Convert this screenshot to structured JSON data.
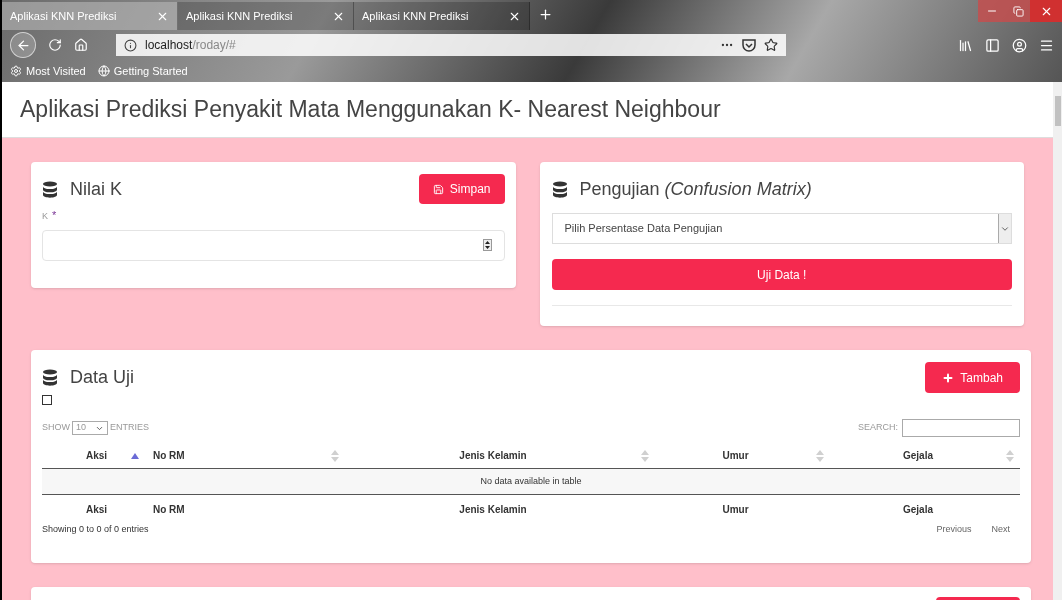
{
  "browser": {
    "tabs": [
      {
        "label": "Aplikasi KNN Prediksi",
        "selected": true
      },
      {
        "label": "Aplikasi KNN Prediksi",
        "selected": false
      },
      {
        "label": "Aplikasi KNN Prediksi",
        "selected": false
      }
    ],
    "url_host": "localhost",
    "url_path": "/roday/#",
    "bookmarks": [
      "Most Visited",
      "Getting Started"
    ]
  },
  "page_title": "Aplikasi Prediksi Penyakit Mata Menggunakan K- Nearest Neighbour",
  "nilai_k": {
    "title": "Nilai K",
    "save_button": "Simpan",
    "field_label": "K",
    "required_mark": "*"
  },
  "pengujian": {
    "title": "Pengujian",
    "title_note": "(Confusion Matrix)",
    "select_placeholder": "Pilih Persentase Data Pengujian",
    "test_button": "Uji Data !"
  },
  "data_uji": {
    "title": "Data Uji",
    "checkbox_checked": false,
    "add_button": "Tambah",
    "show_label": "SHOW",
    "page_size": "10",
    "entries_label": "ENTRIES",
    "search_label": "SEARCH:",
    "columns": [
      {
        "label": "Aksi",
        "sorted": true
      },
      {
        "label": "No RM",
        "sorted": false
      },
      {
        "label": "Jenis Kelamin",
        "sorted": false
      },
      {
        "label": "Umur",
        "sorted": false
      },
      {
        "label": "Gejala",
        "sorted": false
      }
    ],
    "footer_columns": [
      "Aksi",
      "No RM",
      "Jenis Kelamin",
      "Umur",
      "Gejala"
    ],
    "empty_message": "No data available in table",
    "info": "Showing 0 to 0 of 0 entries",
    "pagination": [
      "Previous",
      "Next"
    ]
  }
}
